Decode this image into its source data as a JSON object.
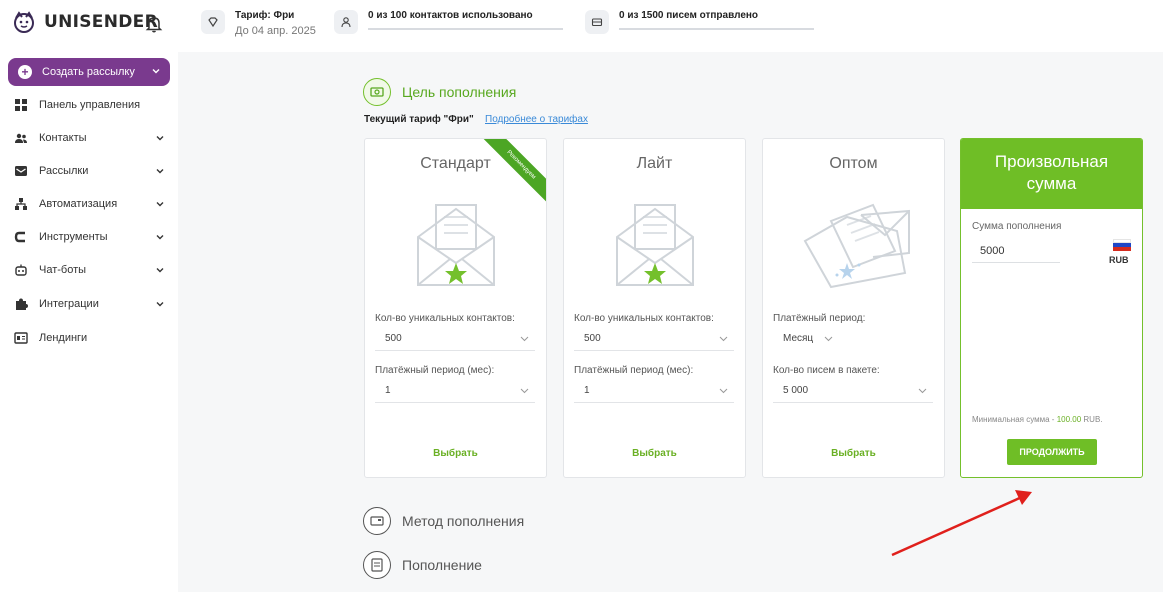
{
  "app": {
    "logo_text": "UNISENDER"
  },
  "topbar": {
    "tariff_title": "Тариф: Фри",
    "tariff_until": "До 04 апр. 2025",
    "contacts_text": "0 из 100 контактов использовано",
    "letters_text": "0 из 1500 писем отправлено",
    "contacts_used_fraction": 0,
    "letters_sent_fraction": 0
  },
  "sidebar": {
    "create_label": "Создать рассылку",
    "items": [
      {
        "label": "Панель управления",
        "icon": "dashboard-icon",
        "has_chevron": false
      },
      {
        "label": "Контакты",
        "icon": "contacts-icon",
        "has_chevron": true
      },
      {
        "label": "Рассылки",
        "icon": "mail-icon",
        "has_chevron": true
      },
      {
        "label": "Автоматизация",
        "icon": "automation-icon",
        "has_chevron": true
      },
      {
        "label": "Инструменты",
        "icon": "tools-icon",
        "has_chevron": true
      },
      {
        "label": "Чат-боты",
        "icon": "chatbot-icon",
        "has_chevron": true
      },
      {
        "label": "Интеграции",
        "icon": "puzzle-icon",
        "has_chevron": true
      },
      {
        "label": "Лендинги",
        "icon": "landing-icon",
        "has_chevron": false
      }
    ]
  },
  "steps": {
    "goal": "Цель пополнения",
    "method": "Метод пополнения",
    "topup": "Пополнение"
  },
  "tariff": {
    "current": "Текущий тариф \"Фри\"",
    "more_link": "Подробнее о тарифах"
  },
  "plans": [
    {
      "title": "Стандарт",
      "ribbon": "Рекомендуем",
      "field1_label": "Кол-во уникальных контактов:",
      "field1_value": "500",
      "field2_label": "Платёжный период (мес):",
      "field2_value": "1",
      "choose": "Выбрать"
    },
    {
      "title": "Лайт",
      "field1_label": "Кол-во уникальных контактов:",
      "field1_value": "500",
      "field2_label": "Платёжный период (мес):",
      "field2_value": "1",
      "choose": "Выбрать"
    },
    {
      "title": "Оптом",
      "field1_label": "Платёжный период:",
      "field1_value": "Месяц",
      "field2_label": "Кол-во писем в пакете:",
      "field2_value": "5 000",
      "choose": "Выбрать"
    }
  ],
  "custom": {
    "title_line1": "Произвольная",
    "title_line2": "сумма",
    "amount_label": "Сумма пополнения",
    "amount_value": "5000",
    "currency": "RUB",
    "min_prefix": "Минимальная сумма - ",
    "min_value": "100.00",
    "min_suffix": " RUB.",
    "continue_label": "ПРОДОЛЖИТЬ"
  },
  "colors": {
    "brand_purple": "#7a3a8e",
    "accent_green": "#6fbe26",
    "annotation_red": "#e0201c"
  }
}
